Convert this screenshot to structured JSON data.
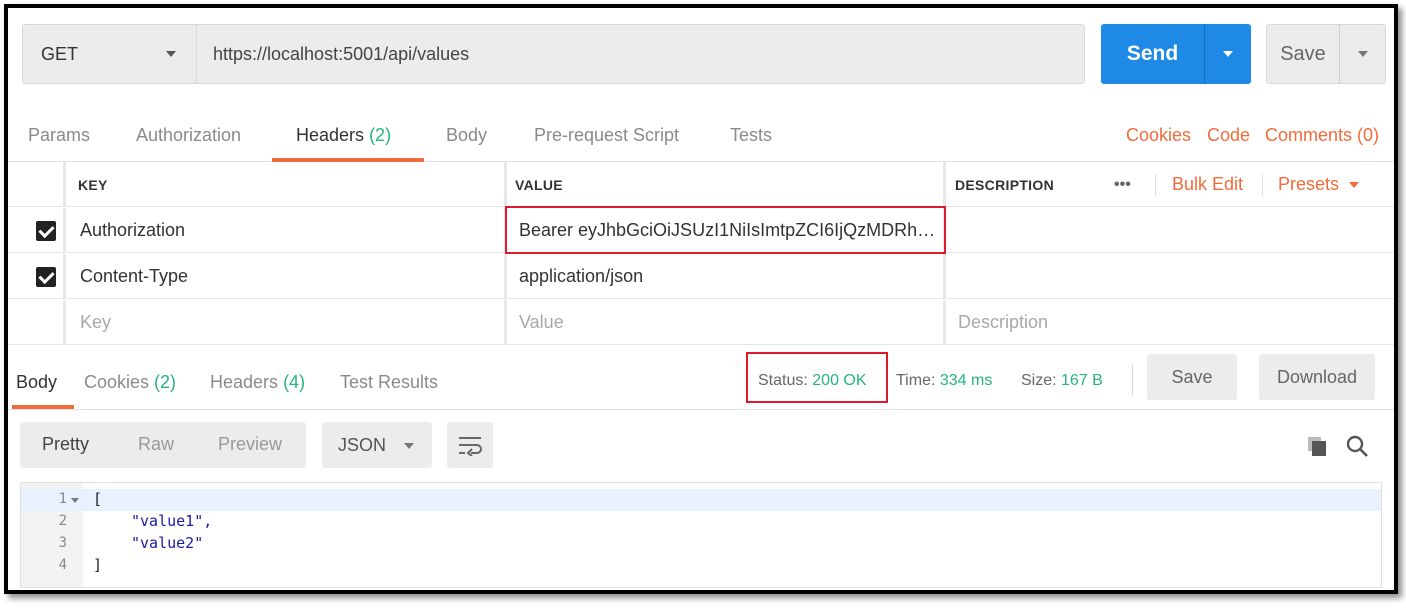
{
  "request": {
    "method": "GET",
    "url": "https://localhost:5001/api/values",
    "send_label": "Send",
    "save_label": "Save"
  },
  "request_tabs": {
    "params": "Params",
    "authorization": "Authorization",
    "headers": "Headers",
    "headers_count": "(2)",
    "body": "Body",
    "prerequest": "Pre-request Script",
    "tests": "Tests"
  },
  "right_links": {
    "cookies": "Cookies",
    "code": "Code",
    "comments": "Comments (0)"
  },
  "headers_table": {
    "columns": {
      "key": "KEY",
      "value": "VALUE",
      "description": "DESCRIPTION"
    },
    "more": "•••",
    "bulk_edit": "Bulk Edit",
    "presets": "Presets",
    "rows": [
      {
        "key": "Authorization",
        "value": "Bearer eyJhbGciOiJSUzI1NiIsImtpZCI6IjQzMDRh…",
        "checked": true
      },
      {
        "key": "Content-Type",
        "value": "application/json",
        "checked": true
      }
    ],
    "placeholder": {
      "key": "Key",
      "value": "Value",
      "description": "Description"
    }
  },
  "response_tabs": {
    "body": "Body",
    "cookies": "Cookies",
    "cookies_count": "(2)",
    "headers": "Headers",
    "headers_count": "(4)",
    "test_results": "Test Results"
  },
  "response_meta": {
    "status_label": "Status:",
    "status_value": "200 OK",
    "time_label": "Time:",
    "time_value": "334 ms",
    "size_label": "Size:",
    "size_value": "167 B",
    "save": "Save",
    "download": "Download"
  },
  "body_toolbar": {
    "pretty": "Pretty",
    "raw": "Raw",
    "preview": "Preview",
    "format": "JSON"
  },
  "response_body": {
    "lines": [
      {
        "num": "1",
        "text": "["
      },
      {
        "num": "2",
        "text": "\"value1\","
      },
      {
        "num": "3",
        "text": "\"value2\""
      },
      {
        "num": "4",
        "text": "]"
      }
    ]
  },
  "colors": {
    "accent": "#f26b3a",
    "send": "#1e8ae6",
    "success": "#26b47f",
    "highlight_box": "#e0192f"
  }
}
